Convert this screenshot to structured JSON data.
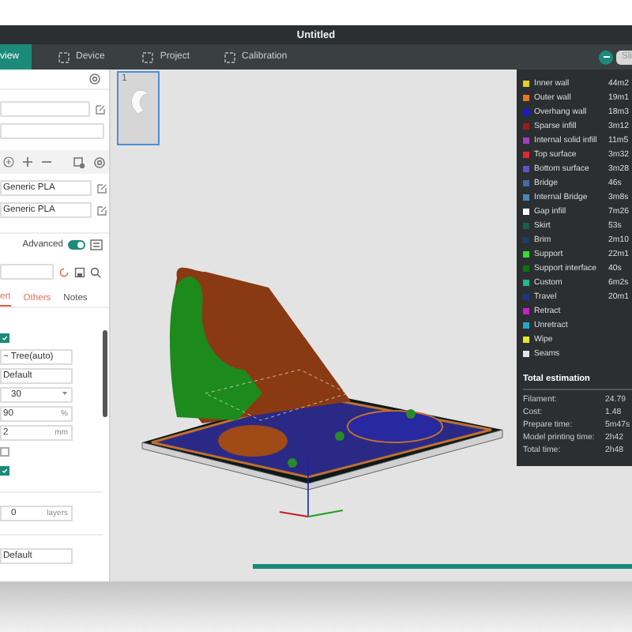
{
  "window": {
    "title": "Untitled"
  },
  "tabs": [
    {
      "label": "view",
      "kind": "plain",
      "selected": true
    },
    {
      "label": "Device",
      "kind": "icon",
      "selected": false
    },
    {
      "label": "Project",
      "kind": "icon",
      "selected": false
    },
    {
      "label": "Calibration",
      "kind": "icon",
      "selected": false
    }
  ],
  "slice_button": {
    "label": "Sli"
  },
  "left_panel": {
    "filaments": [
      {
        "value": "Generic PLA"
      },
      {
        "value": "Generic PLA"
      }
    ],
    "mode": {
      "label": "Advanced",
      "on": true
    },
    "setting_tabs": [
      {
        "label": "ert",
        "selected": true
      },
      {
        "label": "Others",
        "selected": false
      },
      {
        "label": "Notes",
        "selected": false
      }
    ],
    "settings": [
      {
        "kind": "checkbox",
        "checked": true
      },
      {
        "kind": "select",
        "value": "~ Tree(auto)"
      },
      {
        "kind": "select",
        "value": "Default"
      },
      {
        "kind": "spin",
        "value": "30"
      },
      {
        "kind": "number",
        "value": "90",
        "unit": "%"
      },
      {
        "kind": "number",
        "value": "2",
        "unit": "mm"
      },
      {
        "kind": "checkbox",
        "checked": false
      },
      {
        "kind": "checkbox",
        "checked": true
      },
      {
        "kind": "divider"
      },
      {
        "kind": "spin",
        "value": "0",
        "unit": "layers"
      },
      {
        "kind": "divider"
      },
      {
        "kind": "select",
        "value": "Default"
      }
    ]
  },
  "plate_thumbnail": {
    "index": "1",
    "selected": true
  },
  "legend": {
    "items": [
      {
        "label": "Inner wall",
        "time": "44m2",
        "color": "#e2d21e"
      },
      {
        "label": "Outer wall",
        "time": "19m1",
        "color": "#e8742a"
      },
      {
        "label": "Overhang wall",
        "time": "18m3",
        "color": "#1818e0"
      },
      {
        "label": "Sparse infill",
        "time": "3m12",
        "color": "#a01818"
      },
      {
        "label": "Internal solid infill",
        "time": "11m5",
        "color": "#a040c0"
      },
      {
        "label": "Top surface",
        "time": "3m32",
        "color": "#e02828"
      },
      {
        "label": "Bottom surface",
        "time": "3m28",
        "color": "#6450c8"
      },
      {
        "label": "Bridge",
        "time": "46s",
        "color": "#4a68a8"
      },
      {
        "label": "Internal Bridge",
        "time": "3m8s",
        "color": "#4a88b8"
      },
      {
        "label": "Gap infill",
        "time": "7m26",
        "color": "#ffffff"
      },
      {
        "label": "Skirt",
        "time": "53s",
        "color": "#1c5c4c"
      },
      {
        "label": "Brim",
        "time": "2m10",
        "color": "#1c3c6c"
      },
      {
        "label": "Support",
        "time": "22m1",
        "color": "#30e030"
      },
      {
        "label": "Support interface",
        "time": "40s",
        "color": "#107010"
      },
      {
        "label": "Custom",
        "time": "6m2s",
        "color": "#20b888"
      },
      {
        "label": "Travel",
        "time": "20m1",
        "color": "#203488"
      },
      {
        "label": "Retract",
        "color": "#c820c8"
      },
      {
        "label": "Unretract",
        "color": "#20a8c8"
      },
      {
        "label": "Wipe",
        "color": "#e8e820"
      },
      {
        "label": "Seams",
        "color": "#e4e4e4"
      }
    ]
  },
  "estimation": {
    "title": "Total estimation",
    "rows": [
      {
        "label": "Filament:",
        "value": "24.79"
      },
      {
        "label": "Cost:",
        "value": "1.48"
      },
      {
        "label": "Prepare time:",
        "value": "5m47s"
      },
      {
        "label": "Model printing time:",
        "value": "2h42"
      },
      {
        "label": "Total time:",
        "value": "2h48"
      }
    ]
  },
  "layer_slider": {
    "level": 1
  }
}
